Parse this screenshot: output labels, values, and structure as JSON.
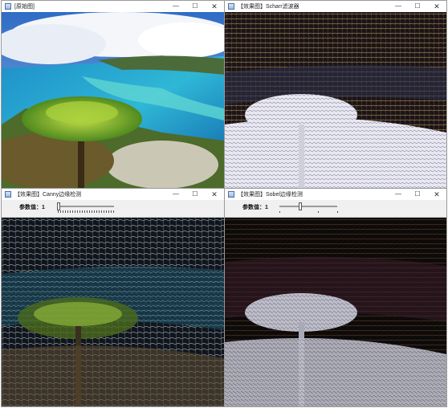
{
  "windows": {
    "original": {
      "title": "[原始图]"
    },
    "scharr": {
      "title": "【效果图】Scharr滤波器"
    },
    "canny": {
      "title": "【效果图】Canny边缘检测",
      "trackbar_label": "参数值：1",
      "trackbar_value": 1
    },
    "sobel": {
      "title": "【效果图】Sobel边缘检测",
      "trackbar_label": "参数值：1",
      "trackbar_value": 1
    }
  },
  "window_controls": {
    "minimize": "—",
    "maximize": "☐",
    "close": "✕"
  },
  "icons": {
    "app": "opencv-window-icon"
  },
  "colors": {
    "ocean": "#1f8fc4",
    "lagoon": "#4fd3d8",
    "sky": "#3a78c9",
    "foliage": "#5b8a2a"
  }
}
